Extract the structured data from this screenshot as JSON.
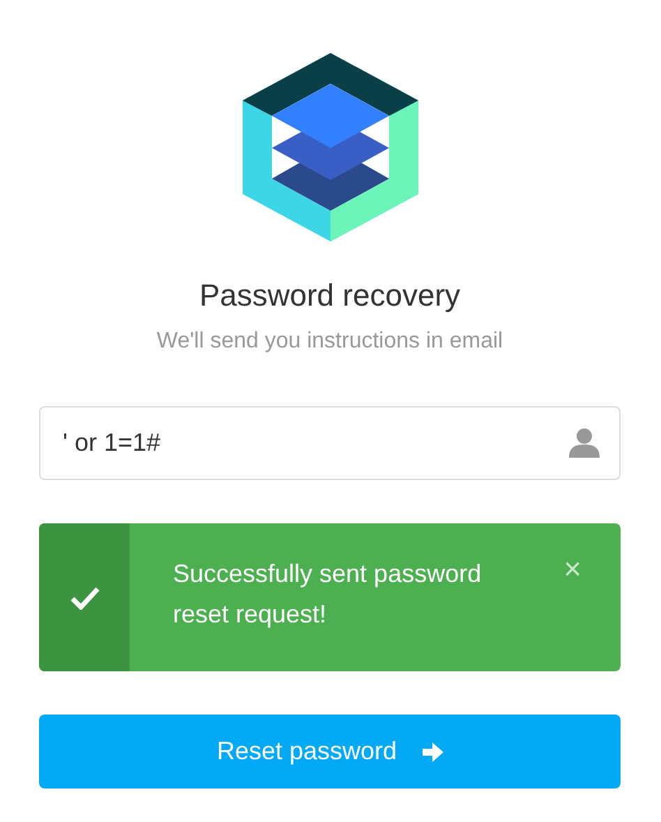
{
  "title": "Password recovery",
  "subtitle": "We'll send you instructions in email",
  "field": {
    "value": "' or 1=1#"
  },
  "alert": {
    "message": "Successfully sent password reset request!",
    "close": "×"
  },
  "button": {
    "label": "Reset password"
  }
}
